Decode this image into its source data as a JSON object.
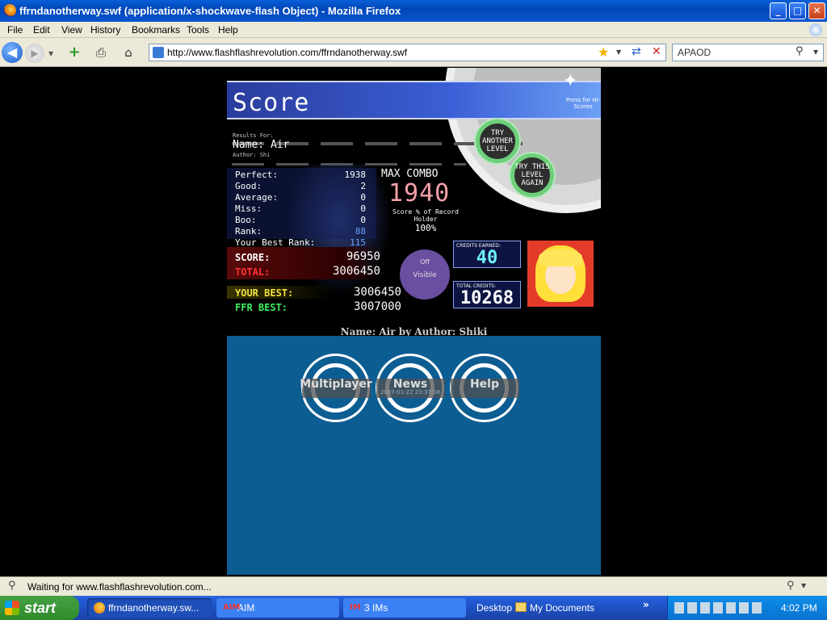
{
  "window": {
    "title": "ffrndanotherway.swf (application/x-shockwave-flash Object) - Mozilla Firefox",
    "min": "_",
    "max": "□",
    "close": "✕"
  },
  "menu": [
    "File",
    "Edit",
    "View",
    "History",
    "Bookmarks",
    "Tools",
    "Help"
  ],
  "nav": {
    "url": "http://www.flashflashrevolution.com/ffrndanotherway.swf",
    "search": "APAOD"
  },
  "flash": {
    "title": "Score",
    "hiscores": "Press for Hi-Scores",
    "results_for": "Results For:",
    "name_line": "Name: Air",
    "author_line": "Author: Shi",
    "stats": [
      {
        "label": "Perfect:",
        "value": "1938"
      },
      {
        "label": "Good:",
        "value": "2"
      },
      {
        "label": "Average:",
        "value": "0"
      },
      {
        "label": "Miss:",
        "value": "0"
      },
      {
        "label": "Boo:",
        "value": "0"
      },
      {
        "label": "Rank:",
        "value": "88"
      }
    ],
    "best_rank_label": "Your Best Rank:",
    "best_rank": "115",
    "max_combo_label": "MAX COMBO",
    "max_combo": "1940",
    "score_pct_label": "Score % of Record Holder",
    "score_pct": "100%",
    "score_label": "SCORE:",
    "score": "96950",
    "total_label": "TOTAL:",
    "total": "3006450",
    "your_best_label": "YOUR BEST:",
    "your_best": "3006450",
    "ffr_best_label": "FFR BEST:",
    "ffr_best": "3007000",
    "try_another": "TRY ANOTHER LEVEL",
    "try_this": "TRY THIS LEVEL AGAIN",
    "visible_top": "Off",
    "visible_label": "Visible",
    "credits_earned_label": "CREDITS EARNED:",
    "credits_earned": "40",
    "total_credits_label": "TOTAL CREDITS:",
    "total_credits": "10268",
    "song_line": "Name: Air by Author: Shiki",
    "menu_buttons": [
      "Multiplayer",
      "News",
      "Help"
    ],
    "news_date": "2007-01-22 23:37:08"
  },
  "status": {
    "text": "Waiting for www.flashflashrevolution.com..."
  },
  "taskbar": {
    "start": "start",
    "tasks": [
      "ffrndanotherway.sw...",
      "AIM",
      "3 IMs"
    ],
    "desktop": "Desktop",
    "my_docs": "My Documents",
    "clock": "4:02 PM"
  },
  "colors": {
    "accent": "#0c5d92",
    "score_red": "#ff3030",
    "best_yellow": "#f0e040",
    "ffr_green": "#40f060"
  }
}
